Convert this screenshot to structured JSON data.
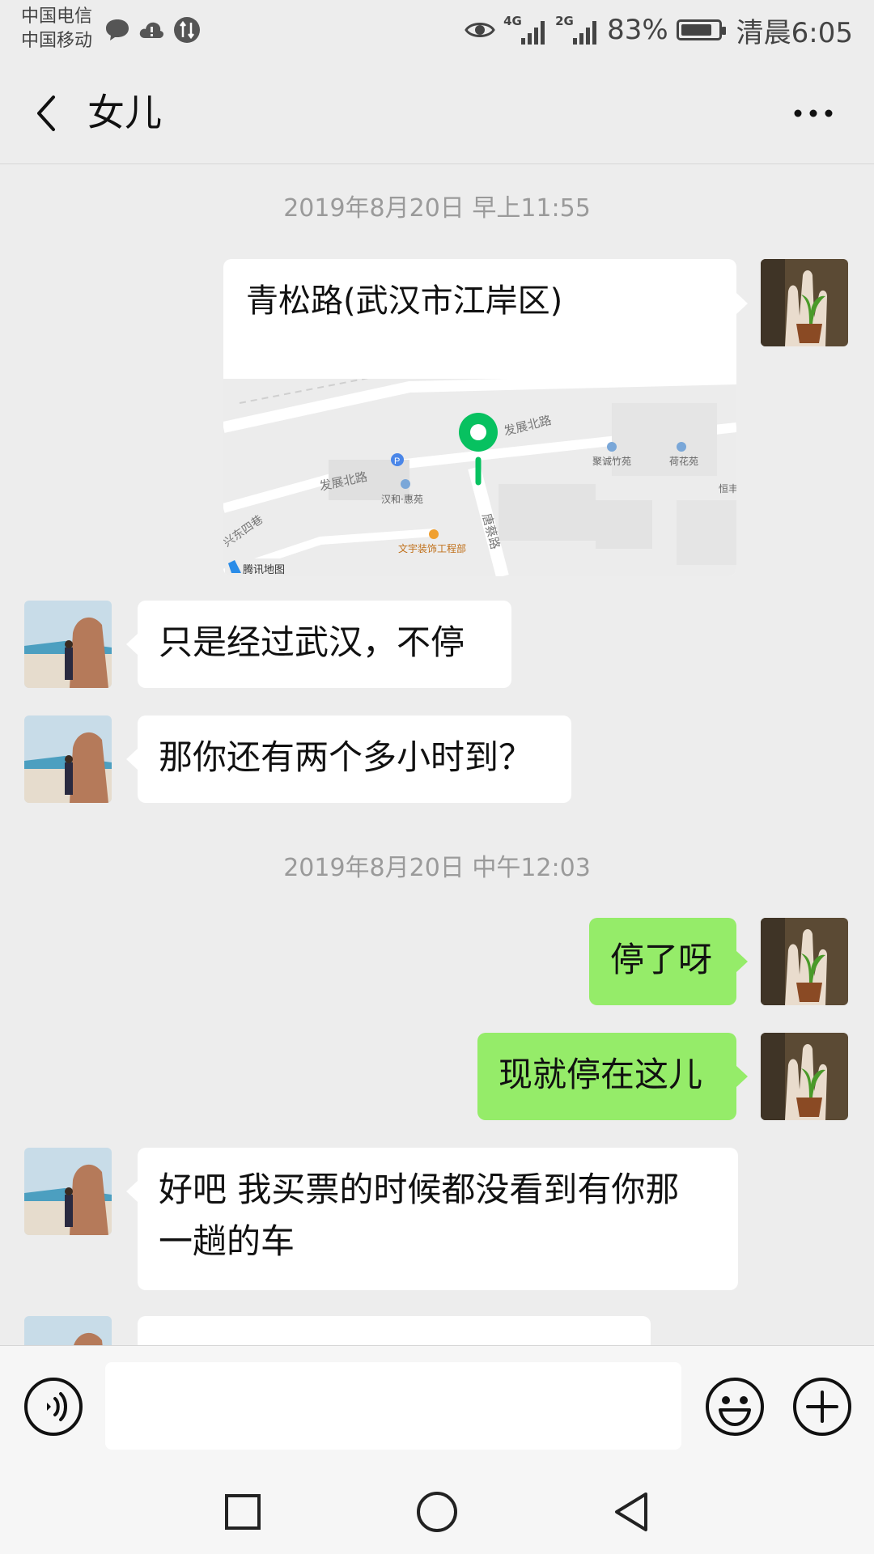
{
  "status_bar": {
    "carrier_1": "中国电信",
    "carrier_2": "中国移动",
    "network_1": "4G",
    "network_2": "2G",
    "battery_percent": "83%",
    "battery_level": 0.83,
    "time": "清晨6:05"
  },
  "header": {
    "title": "女儿"
  },
  "messages": {
    "ts1": "2019年8月20日 早上11:55",
    "location_title": "青松路(武汉市江岸区)",
    "map": {
      "road_1": "发展北路",
      "road_2": "发展北路",
      "road_3": "唐蔡路",
      "road_4": "兴东四巷",
      "poi_1": "汉和·惠苑",
      "poi_2": "聚诚竹苑",
      "poi_3": "荷花苑",
      "poi_4": "文宇装饰工程部",
      "poi_5": "恒丰",
      "attribution": "腾讯地图"
    },
    "msg1": "只是经过武汉，不停",
    "msg2": "那你还有两个多小时到？",
    "ts2": "2019年8月20日 中午12:03",
    "msg3": "停了呀",
    "msg4": "现就停在这儿",
    "msg5_line1": "好吧 我买票的时候都没看到有你那",
    "msg5_line2": "一趟的车"
  },
  "colors": {
    "background": "#ededed",
    "outgoing_bubble": "#95ec69",
    "incoming_bubble": "#ffffff",
    "map_pin": "#07c160"
  },
  "icons": {
    "back": "chevron-left-icon",
    "more": "more-dots-icon",
    "voice": "voice-icon",
    "emoji": "emoji-icon",
    "plus": "plus-icon",
    "nav_recent": "square-icon",
    "nav_home": "circle-icon",
    "nav_back": "triangle-back-icon"
  }
}
